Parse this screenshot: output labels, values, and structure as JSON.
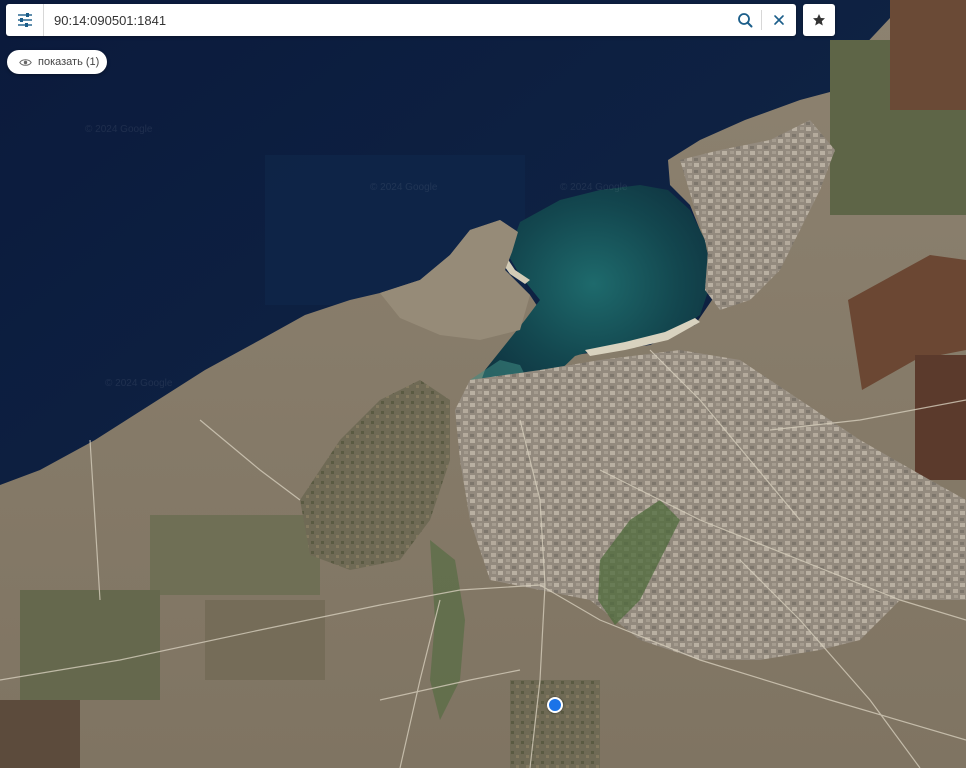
{
  "search": {
    "value": "90:14:090501:1841"
  },
  "filter": {
    "show_label": "показать (1)"
  },
  "map": {
    "type": "satellite",
    "watermark": "© 2024 Google",
    "colors": {
      "sea_deep": "#0d1b3a",
      "sea_mid": "#12304a",
      "bay": "#1d5a60",
      "shallows": "#3d8a83",
      "land": "#8a7f6a",
      "town": "#9a9186",
      "field_brown": "#6b4a35",
      "field_green": "#5f6a48",
      "roads": "#cfc7b6",
      "marker": "#1a73e8"
    }
  },
  "icons": {
    "menu": "sliders-icon",
    "search": "search-icon",
    "clear": "close-icon",
    "favorite": "star-icon",
    "show": "eye-icon",
    "marker": "location-marker"
  }
}
